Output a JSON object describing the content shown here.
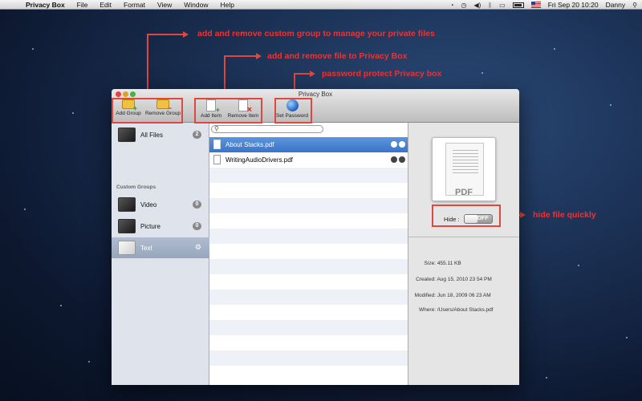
{
  "menubar": {
    "app_name": "Privacy Box",
    "menus": [
      "File",
      "Edit",
      "Format",
      "View",
      "Window",
      "Help"
    ],
    "clock": "Fri Sep 20  10:20",
    "user": "Danny"
  },
  "annotations": {
    "groups": "add and remove custom group to manage your private files",
    "files": "add and remove file to Privacy Box",
    "password": "password protect Privacy box",
    "hide": "hide file quickly"
  },
  "window": {
    "title": "Privacy Box",
    "toolbar": {
      "add_group": "Add Group",
      "remove_group": "Remove Group",
      "add_item": "Add Item",
      "remove_item": "Remove Item",
      "set_password": "Set Password"
    }
  },
  "sidebar": {
    "all_files": {
      "label": "All Files",
      "count": "2"
    },
    "custom_groups_header": "Custom Groups",
    "groups": [
      {
        "label": "Video",
        "count": "0"
      },
      {
        "label": "Picture",
        "count": "0"
      },
      {
        "label": "Text"
      }
    ]
  },
  "files": [
    {
      "name": "About Stacks.pdf"
    },
    {
      "name": "WritingAudioDrivers.pdf"
    }
  ],
  "detail": {
    "preview_label": "PDF",
    "hide_label": "Hide :",
    "toggle_state": "OFF",
    "info": {
      "size_k": "Size:",
      "size_v": "455.11 KB",
      "created_k": "Created:",
      "created_v": "Aug 15, 2010 23 54 PM",
      "modified_k": "Modified:",
      "modified_v": "Jun 18, 2009 06 23 AM",
      "where_k": "Where:",
      "where_v": "/Users/About Stacks.pdf"
    }
  },
  "colors": {
    "annotation": "#e0473e",
    "selection": "#3a74c8"
  }
}
